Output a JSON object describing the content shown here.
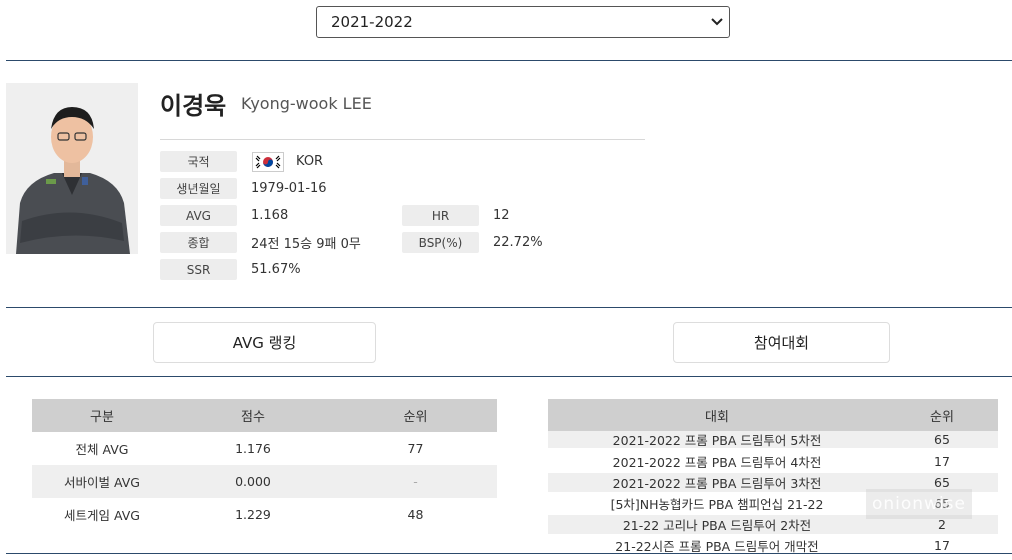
{
  "season_select": {
    "value": "2021-2022",
    "icon": "chevron-down-icon"
  },
  "player": {
    "name_ko": "이경욱",
    "name_en": "Kyong-wook LEE",
    "fields": {
      "nationality": {
        "label": "국적",
        "value": "KOR"
      },
      "birthdate": {
        "label": "생년월일",
        "value": "1979-01-16"
      },
      "avg": {
        "label": "AVG",
        "value": "1.168"
      },
      "hr": {
        "label": "HR",
        "value": "12"
      },
      "record": {
        "label": "종합",
        "value": "24전 15승 9패 0무"
      },
      "bsp": {
        "label": "BSP(%)",
        "value": "22.72%"
      },
      "ssr": {
        "label": "SSR",
        "value": "51.67%"
      }
    }
  },
  "tabs": {
    "avg_ranking": "AVG 랭킹",
    "tournaments": "참여대회"
  },
  "avg_table": {
    "headers": [
      "구분",
      "점수",
      "순위"
    ],
    "rows": [
      [
        "전체 AVG",
        "1.176",
        "77"
      ],
      [
        "서바이벌 AVG",
        "0.000",
        "-"
      ],
      [
        "세트게임 AVG",
        "1.229",
        "48"
      ]
    ]
  },
  "tournament_table": {
    "headers": [
      "대회",
      "순위"
    ],
    "rows": [
      [
        "2021-2022 프롬 PBA 드림투어 5차전",
        "65"
      ],
      [
        "2021-2022 프롬 PBA 드림투어 4차전",
        "17"
      ],
      [
        "2021-2022 프롬 PBA 드림투어 3차전",
        "65"
      ],
      [
        "[5차]NH농협카드 PBA 챔피언십 21-22",
        "65"
      ],
      [
        "21-22 고리나 PBA 드림투어 2차전",
        "2"
      ],
      [
        "21-22시즌 프롬 PBA 드림투어 개막전",
        "17"
      ]
    ]
  },
  "watermark": "onionwise",
  "colors": {
    "divider": "#2c4a6b",
    "table_header": "#cfcfcf",
    "row_alt": "#efefef",
    "label_bg": "#ededed"
  }
}
